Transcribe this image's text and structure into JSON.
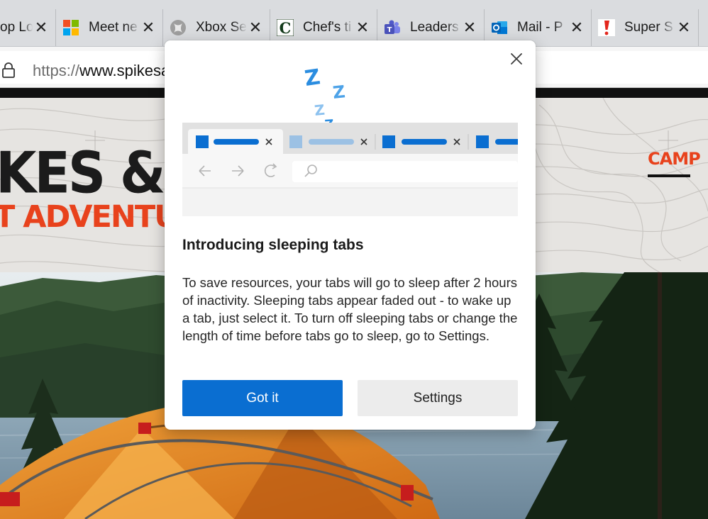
{
  "tabs": [
    {
      "title": "op Lo",
      "favicon": "unknown"
    },
    {
      "title": "Meet ne",
      "favicon": "microsoft-logo"
    },
    {
      "title": "Xbox Se",
      "favicon": "xbox-logo"
    },
    {
      "title": "Chef's ti",
      "favicon": "c-letter-logo"
    },
    {
      "title": "Leaders",
      "favicon": "teams-logo"
    },
    {
      "title": "Mail - P",
      "favicon": "outlook-logo"
    },
    {
      "title": "Super S",
      "favicon": "exclamation-logo"
    }
  ],
  "address_bar": {
    "scheme": "https://",
    "host": "www.spikesa"
  },
  "website": {
    "brand_line_1": "KES & VA",
    "brand_line_2": "T ADVENTURE",
    "nav_item": "CAMP",
    "accent_color": "#e8421c"
  },
  "dialog": {
    "title": "Introducing sleeping tabs",
    "body": "To save resources, your tabs will go to sleep after 2 hours of inactivity. Sleeping tabs appear faded out - to wake up a tab, just select it. To turn off sleeping tabs or change the length of time before tabs go to sleep, go to Settings.",
    "primary_button": "Got it",
    "secondary_button": "Settings",
    "primary_color": "#0a6ed1",
    "illustration_letters": [
      "Z",
      "Z",
      "Z",
      "Z"
    ]
  }
}
